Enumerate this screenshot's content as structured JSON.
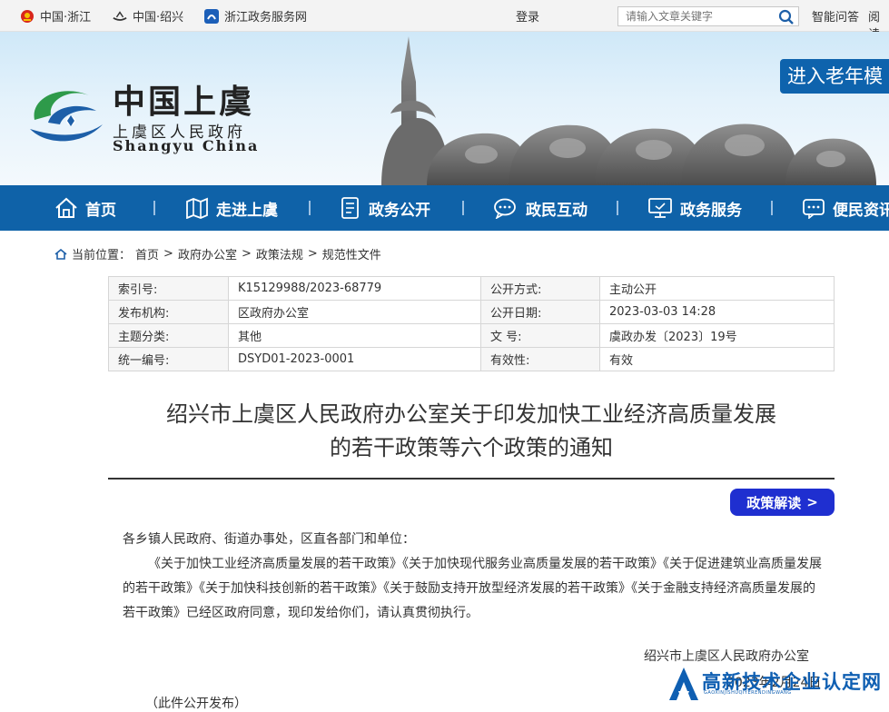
{
  "topbar": {
    "links": [
      "中国·浙江",
      "中国·绍兴",
      "浙江政务服务网"
    ],
    "login": "登录",
    "search_placeholder": "请输入文章关键字",
    "right_links": [
      "智能问答",
      "阅读"
    ]
  },
  "banner": {
    "logo_title": "中国上虞",
    "logo_sub": "上虞区人民政府",
    "logo_en": "Shangyu  China",
    "elder_mode": "进入老年模"
  },
  "nav": {
    "items": [
      {
        "label": "首页",
        "icon": "home-icon"
      },
      {
        "label": "走进上虞",
        "icon": "map-icon"
      },
      {
        "label": "政务公开",
        "icon": "document-icon"
      },
      {
        "label": "政民互动",
        "icon": "chat-icon"
      },
      {
        "label": "政务服务",
        "icon": "monitor-icon"
      },
      {
        "label": "便民资讯",
        "icon": "message-icon"
      }
    ]
  },
  "breadcrumb": {
    "prefix": "当前位置：",
    "items": [
      "首页",
      "政府办公室",
      "政策法规",
      "规范性文件"
    ],
    "sep": ">"
  },
  "meta": {
    "rows": [
      [
        "索引号:",
        "K15129988/2023-68779",
        "公开方式:",
        "主动公开"
      ],
      [
        "发布机构:",
        "区政府办公室",
        "公开日期:",
        "2023-03-03 14:28"
      ],
      [
        "主题分类:",
        "其他",
        "文  号:",
        "虞政办发〔2023〕19号"
      ],
      [
        "统一编号:",
        "DSYD01-2023-0001",
        "有效性:",
        "有效"
      ]
    ]
  },
  "article": {
    "title_line1": "绍兴市上虞区人民政府办公室关于印发加快工业经济高质量发展",
    "title_line2": "的若干政策等六个政策的通知",
    "interpret_label": "政策解读",
    "interpret_arrow": ">",
    "salutation": "各乡镇人民政府、街道办事处，区直各部门和单位：",
    "paragraph": "《关于加快工业经济高质量发展的若干政策》《关于加快现代服务业高质量发展的若干政策》《关于促进建筑业高质量发展的若干政策》《关于加快科技创新的若干政策》《关于鼓励支持开放型经济发展的若干政策》《关于金融支持经济高质量发展的若干政策》已经区政府同意，现印发给你们，请认真贯彻执行。",
    "signature": "绍兴市上虞区人民政府办公室",
    "date": "2023年2月24日",
    "note": "（此件公开发布）"
  },
  "watermark": {
    "text": "高新技术企业认定网",
    "sub": "GAOXINJISHUQIYERENDINGWANG"
  },
  "colors": {
    "nav_blue": "#0f62a8",
    "interp_blue": "#1f2fd0",
    "logo_green": "#2e9a4a"
  }
}
